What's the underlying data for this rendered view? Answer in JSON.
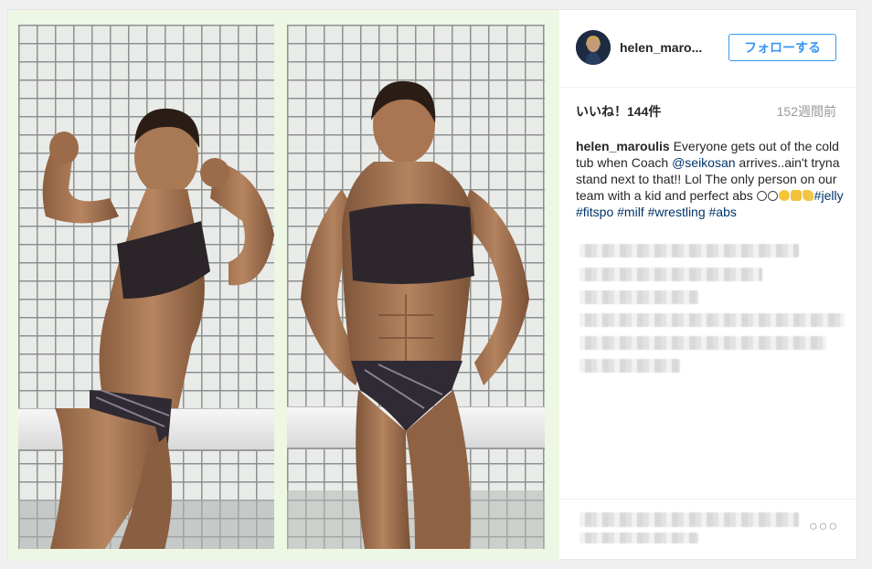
{
  "post": {
    "username": "helen_maro...",
    "follow_label": "フォローする",
    "likes": "いいね！144件",
    "time_ago": "152週間前",
    "caption": {
      "username": "helen_maroulis",
      "text_1": " Everyone gets out of the cold tub when Coach ",
      "mention": "@seikosan",
      "text_2": " arrives..ain't tryna stand next to that!! Lol The only person on our team with a kid and perfect abs ",
      "hashtags": [
        "#jelly",
        "#fitspo",
        "#milf",
        "#wrestling",
        "#abs"
      ]
    },
    "more_icon": "more-options-icon",
    "more_label": "○○○"
  },
  "colors": {
    "accent": "#3897f0",
    "link": "#003569",
    "text": "#262626",
    "muted": "#999999"
  }
}
